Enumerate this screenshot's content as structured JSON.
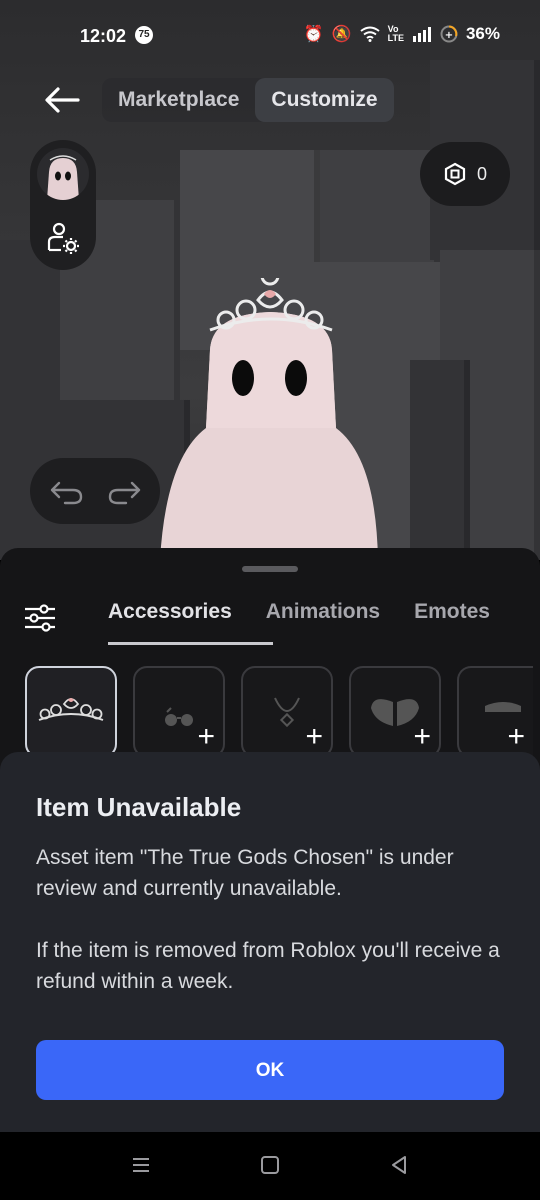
{
  "status_bar": {
    "time": "12:02",
    "notification_badge": "75",
    "battery_percent": "36%",
    "icons": [
      "alarm-icon",
      "mute-icon",
      "wifi-icon",
      "volte-icon",
      "signal-icon",
      "battery-icon"
    ]
  },
  "header": {
    "tabs": [
      {
        "label": "Marketplace",
        "active": false
      },
      {
        "label": "Customize",
        "active": true
      }
    ]
  },
  "robux": {
    "balance": "0"
  },
  "sheet": {
    "category_tabs": [
      {
        "label": "Accessories",
        "active": true
      },
      {
        "label": "Animations",
        "active": false
      },
      {
        "label": "Emotes",
        "active": false
      }
    ],
    "item_slots": [
      {
        "icon": "tiara-icon",
        "selected": true
      },
      {
        "icon": "glasses-icon",
        "selected": false
      },
      {
        "icon": "necklace-icon",
        "selected": false
      },
      {
        "icon": "wings-icon",
        "selected": false
      },
      {
        "icon": "hat-icon",
        "selected": false
      }
    ]
  },
  "dialog": {
    "title": "Item Unavailable",
    "paragraph_1": "Asset item \"The True Gods Chosen\" is under review and currently unavailable.",
    "paragraph_2": "If the item is removed from Roblox you'll receive a refund within a week.",
    "ok_label": "OK"
  },
  "colors": {
    "dialog_bg": "#23252b",
    "ok_button": "#3a67f8",
    "sheet_bg": "#151517"
  }
}
